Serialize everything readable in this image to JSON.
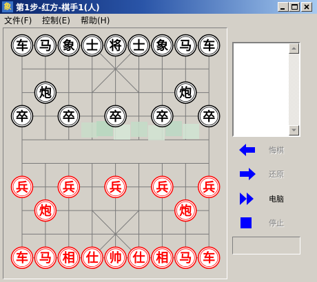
{
  "window": {
    "title": "第1步-红方-棋手1(人)",
    "app_icon_char": "象",
    "minimize_icon": "minimize-icon",
    "maximize_icon": "maximize-icon",
    "close_icon": "close-icon"
  },
  "menu": {
    "file": "文件(F)",
    "control": "控制(E)",
    "help": "帮助(H)"
  },
  "colors": {
    "red_piece": "#ff0000",
    "black_piece": "#000000",
    "control_blue": "#0000ff",
    "title_bar": "#0a246a"
  },
  "board": {
    "river_text": "",
    "black_pieces": [
      {
        "char": "车",
        "col": 0,
        "row": 0
      },
      {
        "char": "马",
        "col": 1,
        "row": 0
      },
      {
        "char": "象",
        "col": 2,
        "row": 0
      },
      {
        "char": "士",
        "col": 3,
        "row": 0
      },
      {
        "char": "将",
        "col": 4,
        "row": 0
      },
      {
        "char": "士",
        "col": 5,
        "row": 0
      },
      {
        "char": "象",
        "col": 6,
        "row": 0
      },
      {
        "char": "马",
        "col": 7,
        "row": 0
      },
      {
        "char": "车",
        "col": 8,
        "row": 0
      },
      {
        "char": "炮",
        "col": 1,
        "row": 2
      },
      {
        "char": "炮",
        "col": 7,
        "row": 2
      },
      {
        "char": "卒",
        "col": 0,
        "row": 3
      },
      {
        "char": "卒",
        "col": 2,
        "row": 3
      },
      {
        "char": "卒",
        "col": 4,
        "row": 3
      },
      {
        "char": "卒",
        "col": 6,
        "row": 3
      },
      {
        "char": "卒",
        "col": 8,
        "row": 3
      }
    ],
    "red_pieces": [
      {
        "char": "兵",
        "col": 0,
        "row": 6
      },
      {
        "char": "兵",
        "col": 2,
        "row": 6
      },
      {
        "char": "兵",
        "col": 4,
        "row": 6
      },
      {
        "char": "兵",
        "col": 6,
        "row": 6
      },
      {
        "char": "兵",
        "col": 8,
        "row": 6
      },
      {
        "char": "炮",
        "col": 1,
        "row": 7
      },
      {
        "char": "炮",
        "col": 7,
        "row": 7
      },
      {
        "char": "车",
        "col": 0,
        "row": 9
      },
      {
        "char": "马",
        "col": 1,
        "row": 9
      },
      {
        "char": "相",
        "col": 2,
        "row": 9
      },
      {
        "char": "仕",
        "col": 3,
        "row": 9
      },
      {
        "char": "帅",
        "col": 4,
        "row": 9
      },
      {
        "char": "仕",
        "col": 5,
        "row": 9
      },
      {
        "char": "相",
        "col": 6,
        "row": 9
      },
      {
        "char": "马",
        "col": 7,
        "row": 9
      },
      {
        "char": "车",
        "col": 8,
        "row": 9
      }
    ]
  },
  "move_list": {
    "items": [],
    "up_icon": "scroll-up-arrow-icon",
    "down_icon": "scroll-down-arrow-icon"
  },
  "controls": {
    "undo": {
      "label": "悔棋",
      "icon": "left-arrow-icon",
      "enabled": false
    },
    "redo": {
      "label": "还原",
      "icon": "right-arrow-icon",
      "enabled": false
    },
    "ai_move": {
      "label": "电脑",
      "icon": "fast-forward-icon",
      "enabled": true
    },
    "stop": {
      "label": "停止",
      "icon": "stop-square-icon",
      "enabled": false
    }
  },
  "status": {
    "text": ""
  }
}
